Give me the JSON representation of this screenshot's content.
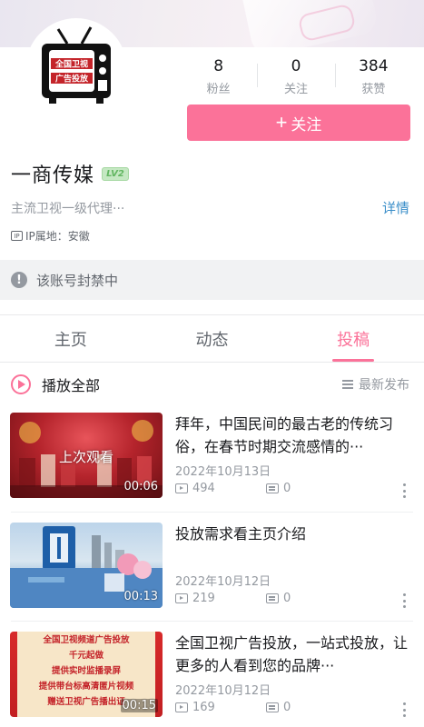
{
  "profile": {
    "avatar_text_line1": "全国卫视",
    "avatar_text_line2": "广告投放",
    "name": "一商传媒",
    "level": "LV2",
    "bio": "主流卫视一级代理···",
    "detail_label": "详情",
    "ip_icon_text": "IP",
    "ip_location": "IP属地：安徽",
    "follow_button": "关注",
    "follow_plus": "+"
  },
  "stats": [
    {
      "value": "8",
      "label": "粉丝"
    },
    {
      "value": "0",
      "label": "关注"
    },
    {
      "value": "384",
      "label": "获赞"
    }
  ],
  "banned_notice": "该账号封禁中",
  "tabs": [
    {
      "label": "主页",
      "active": false
    },
    {
      "label": "动态",
      "active": false
    },
    {
      "label": "投稿",
      "active": true
    }
  ],
  "list_header": {
    "play_all": "播放全部",
    "sort": "最新发布"
  },
  "videos": [
    {
      "title": "拜年，中国民间的最古老的传统习俗，在春节时期交流感情的···",
      "date": "2022年10月13日",
      "views": "494",
      "danmaku": "0",
      "duration": "00:06",
      "overlay": "上次观看"
    },
    {
      "title": "投放需求看主页介绍",
      "date": "2022年10月12日",
      "views": "219",
      "danmaku": "0",
      "duration": "00:13"
    },
    {
      "title": "全国卫视广告投放，一站式投放，让更多的人看到您的品牌···",
      "date": "2022年10月12日",
      "views": "169",
      "danmaku": "0",
      "duration": "00:15",
      "thumb_lines": [
        "全国卫视频道广告投放",
        "千元起做",
        "提供实时监播录屏",
        "提供带台标高清匿片视频",
        "赠送卫视广告播出证"
      ]
    }
  ],
  "colors": {
    "accent": "#fb7299",
    "link": "#3a8ec9",
    "muted": "#9499a0",
    "level_bg": "#c5e8c3"
  }
}
